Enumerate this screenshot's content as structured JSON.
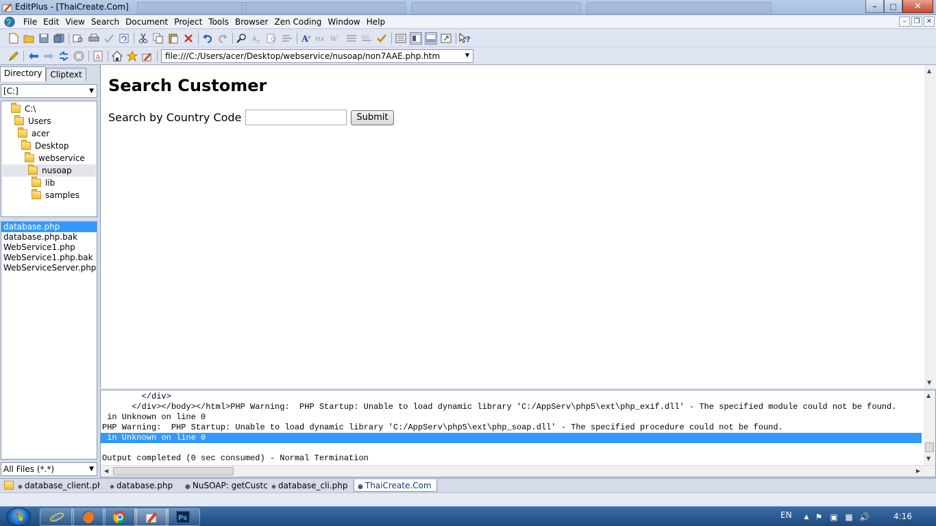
{
  "window": {
    "title": "EditPlus - [ThaiCreate.Com]"
  },
  "menu": {
    "items": [
      "File",
      "Edit",
      "View",
      "Search",
      "Document",
      "Project",
      "Tools",
      "Browser",
      "Zen Coding",
      "Window",
      "Help"
    ]
  },
  "address_bar": {
    "value": "file:///C:/Users/acer/Desktop/webservice/nusoap/non7AAE.php.htm"
  },
  "left_panel": {
    "tabs": [
      "Directory",
      "Cliptext"
    ],
    "active_tab": "Directory",
    "drive": "[C:]",
    "tree": [
      {
        "label": "C:\\",
        "indent": 0
      },
      {
        "label": "Users",
        "indent": 1
      },
      {
        "label": "acer",
        "indent": 2
      },
      {
        "label": "Desktop",
        "indent": 3
      },
      {
        "label": "webservice",
        "indent": 4
      },
      {
        "label": "nusoap",
        "indent": 5,
        "selected": true
      },
      {
        "label": "lib",
        "indent": 6
      },
      {
        "label": "samples",
        "indent": 6
      }
    ],
    "files": [
      "database.php",
      "database.php.bak",
      "WebService1.php",
      "WebService1.php.bak",
      "WebServiceServer.php"
    ],
    "selected_file": "database.php",
    "filter": "All Files (*.*)"
  },
  "browser_page": {
    "heading": "Search Customer",
    "label": "Search by Country Code",
    "input_value": "",
    "submit_label": "Submit"
  },
  "output": {
    "lines": [
      "        </div>",
      "      </div></body></html>PHP Warning:  PHP Startup: Unable to load dynamic library 'C:/AppServ\\php5\\ext\\php_exif.dll' - The specified module could not be found.",
      " in Unknown on line 0",
      "PHP Warning:  PHP Startup: Unable to load dynamic library 'C:/AppServ\\php5\\ext\\php_soap.dll' - The specified procedure could not be found.",
      " in Unknown on line 0",
      "",
      "Output completed (0 sec consumed) - Normal Termination"
    ],
    "selected_line": 4
  },
  "doc_tabs": [
    {
      "label": "database_client.ph",
      "active": false
    },
    {
      "label": "database.php",
      "active": false
    },
    {
      "label": "NuSOAP: getCustc",
      "active": false
    },
    {
      "label": "database_cli.php",
      "active": false
    },
    {
      "label": "ThaiCreate.Com",
      "active": true
    }
  ],
  "taskbar": {
    "language": "EN",
    "time": "4:16",
    "apps": [
      "internet-explorer",
      "firefox",
      "chrome",
      "editplus",
      "photoshop"
    ],
    "photoshop_label": "Ps"
  },
  "colors": {
    "selection": "#3399ff",
    "chrome_bg": "#d6dbe9"
  }
}
